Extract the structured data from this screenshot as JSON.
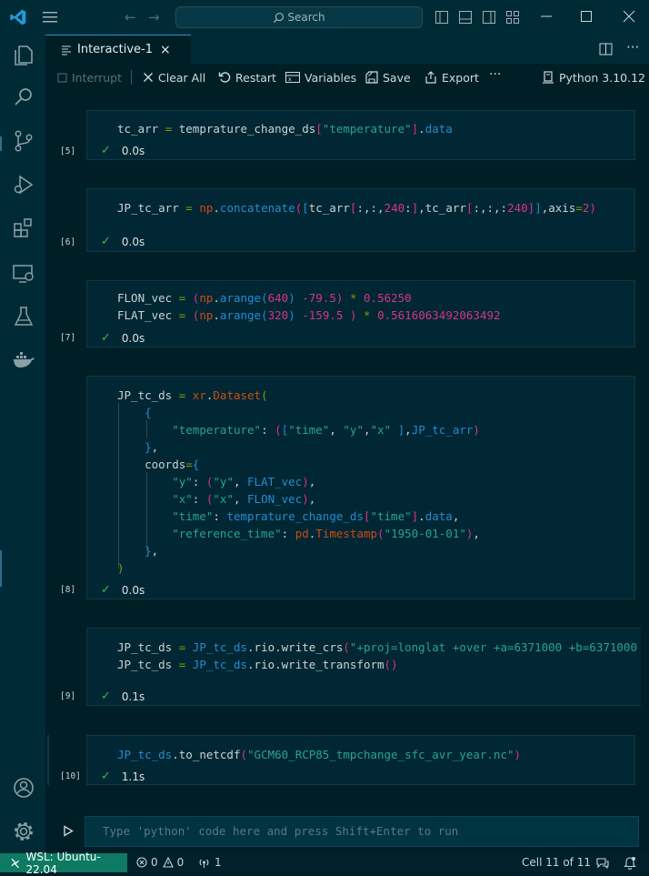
{
  "titlebar": {
    "search_placeholder": "Search"
  },
  "activity_bar": {
    "items": [
      "explorer-icon",
      "search-icon",
      "source-control-icon",
      "run-debug-icon",
      "extensions-icon",
      "remote-explorer-icon",
      "testing-icon",
      "docker-icon"
    ],
    "bottom": [
      "account-icon",
      "settings-gear-icon"
    ]
  },
  "tab": {
    "label": "Interactive-1",
    "close": "×"
  },
  "toolbar": {
    "interrupt": "Interrupt",
    "clear_all": "Clear All",
    "restart": "Restart",
    "variables": "Variables",
    "save": "Save",
    "export": "Export",
    "more": "···",
    "kernel": "Python 3.10.12"
  },
  "cells": [
    {
      "exec": "[5]",
      "time": "0.0s"
    },
    {
      "exec": "[6]",
      "time": "0.0s"
    },
    {
      "exec": "[7]",
      "time": "0.0s"
    },
    {
      "exec": "[8]",
      "time": "0.0s"
    },
    {
      "exec": "[9]",
      "time": "0.1s"
    },
    {
      "exec": "[10]",
      "time": "1.1s"
    }
  ],
  "input": {
    "placeholder": "Type 'python' code here and press Shift+Enter to run"
  },
  "statusbar": {
    "remote": "WSL: Ubuntu-22.04",
    "errors": "0",
    "warnings": "0",
    "ports": "1",
    "cell_position": "Cell 11 of 11"
  },
  "colors": {
    "accent": "#1f9ad5",
    "success": "#3fb950",
    "remote_bg": "#0e7a63"
  }
}
